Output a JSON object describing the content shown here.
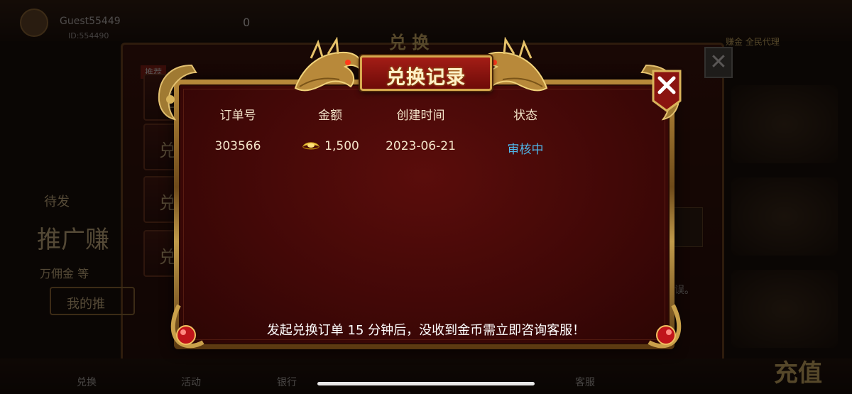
{
  "background": {
    "user_name": "Guest55449",
    "user_id": "ID:554490",
    "coin_value": "0",
    "panel_title": "兑 换",
    "tag_label": "推荐",
    "side_buttons": [
      "兑",
      "兑",
      "兑",
      "兑"
    ],
    "side_text": "待发",
    "promo_text": "推广赚",
    "promo_sub": "万佣金 等",
    "promo_button": "我的推",
    "top_right_labels": "赚金 全民代理",
    "right_char": "误。",
    "bottom_items": [
      "兑换",
      "活动",
      "银行",
      "客服"
    ],
    "bottom_big": "充值"
  },
  "dialog": {
    "title": "兑换记录",
    "columns": [
      "订单号",
      "金额",
      "创建时间",
      "状态"
    ],
    "rows": [
      {
        "order_no": "303566",
        "amount": "1,500",
        "created": "2023-06-21",
        "status": "审核中"
      }
    ],
    "footer_note": "发起兑换订单 15 分钟后，没收到金币需立即咨询客服！"
  },
  "icons": {
    "close": "close-icon",
    "amount": "gold-ingot-icon",
    "decor": "dragon-icon"
  },
  "colors": {
    "status_pending": "#4fb7ea",
    "panel_red": "#420807",
    "gold_frame": "#c09a4a"
  }
}
